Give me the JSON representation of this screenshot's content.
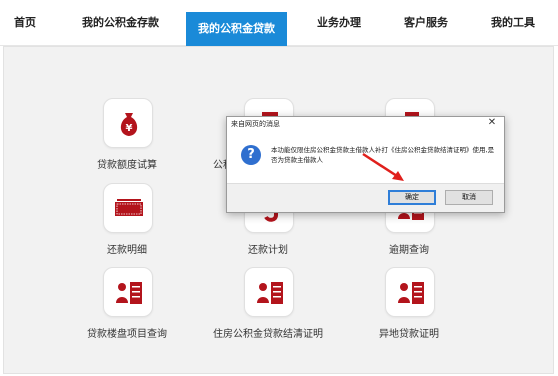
{
  "nav": {
    "items": [
      {
        "label": "首页"
      },
      {
        "label": "我的公积金存款"
      },
      {
        "label": "我的公积金贷款"
      },
      {
        "label": "业务办理"
      },
      {
        "label": "客户服务"
      },
      {
        "label": "我的工具"
      }
    ],
    "active_index": 2
  },
  "tiles": [
    {
      "label": "贷款额度试算",
      "icon": "money-bag-icon"
    },
    {
      "label": "公积金贷款",
      "icon": "calculator-icon"
    },
    {
      "label": "",
      "icon": "document-icon"
    },
    {
      "label": "还款明细",
      "icon": "cash-stack-icon"
    },
    {
      "label": "还款计划",
      "icon": "plan-icon"
    },
    {
      "label": "逾期查询",
      "icon": "list-icon"
    },
    {
      "label": "贷款楼盘项目查询",
      "icon": "list-icon"
    },
    {
      "label": "住房公积金贷款结清证明",
      "icon": "list-icon"
    },
    {
      "label": "异地贷款证明",
      "icon": "list-icon"
    }
  ],
  "dialog": {
    "title": "来自网页的消息",
    "close": "✕",
    "icon": "question-icon",
    "message": "本功能仅限住房公积金贷款主借款人补打《住房公积金贷款结清证明》使用,是否为贷款主借款人",
    "ok_label": "确定",
    "cancel_label": "取消"
  },
  "colors": {
    "accent": "#1a8ad8",
    "icon_red": "#b3141c",
    "arrow_red": "#e0201c"
  }
}
